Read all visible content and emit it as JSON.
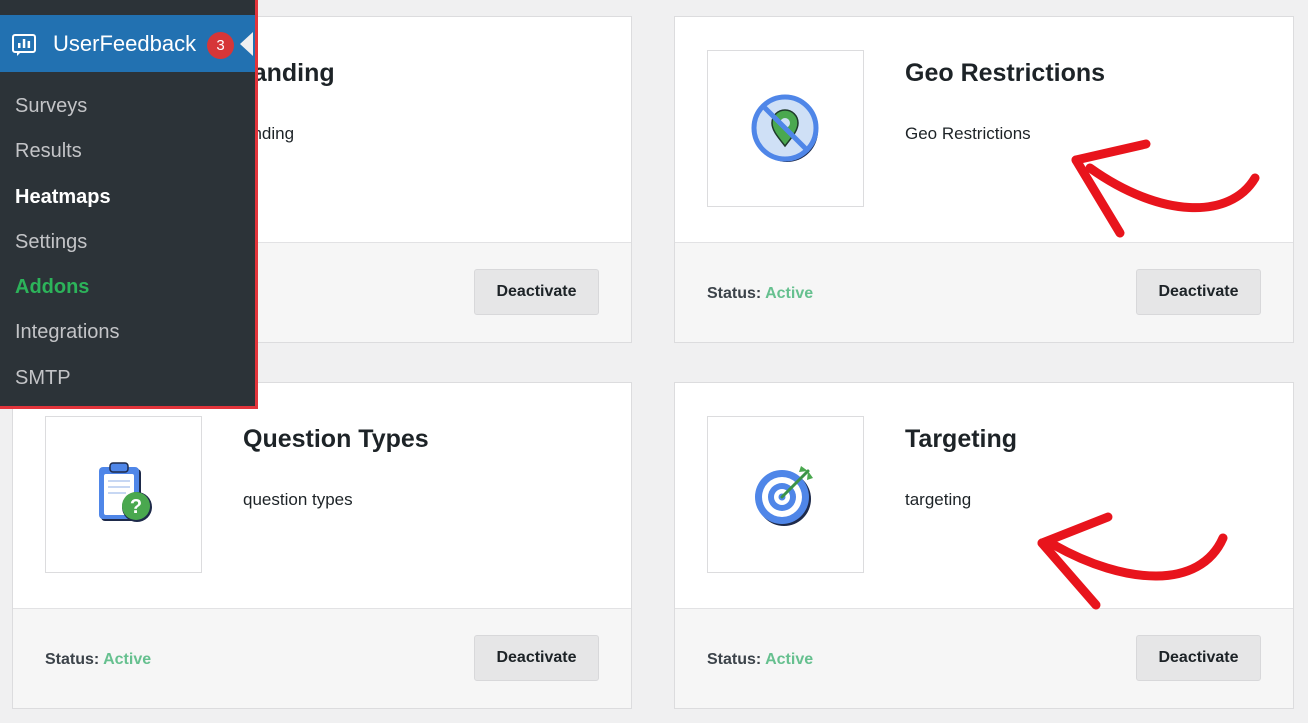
{
  "admin_menu": {
    "plugin_name": "UserFeedback",
    "update_count": "3",
    "items": [
      {
        "label": "Surveys"
      },
      {
        "label": "Results"
      },
      {
        "label": "Heatmaps"
      },
      {
        "label": "Settings"
      },
      {
        "label": "Addons"
      },
      {
        "label": "Integrations"
      },
      {
        "label": "SMTP"
      }
    ],
    "current_item": "Addons"
  },
  "addons": [
    {
      "title": "Branding",
      "title_visible": "randing",
      "description_visible": "anding",
      "deactivate_label": "Deactivate"
    },
    {
      "title": "Geo Restrictions",
      "description": "Geo Restrictions",
      "icon": "geo-restriction-icon",
      "status_label": "Status:",
      "status_value": "Active",
      "deactivate_label": "Deactivate"
    },
    {
      "title": "Question Types",
      "description": "question types",
      "icon": "clipboard-question-icon",
      "status_label": "Status:",
      "status_value": "Active",
      "deactivate_label": "Deactivate"
    },
    {
      "title": "Targeting",
      "description": "targeting",
      "icon": "target-icon",
      "status_label": "Status:",
      "status_value": "Active",
      "deactivate_label": "Deactivate"
    }
  ],
  "colors": {
    "menu_background": "#2c3338",
    "menu_header": "#2271b1",
    "menu_current": "#2cb35a",
    "badge": "#d63638",
    "highlight_border": "#e3343b",
    "status_active": "#66c08f",
    "annotation_arrow": "#e8141c"
  }
}
